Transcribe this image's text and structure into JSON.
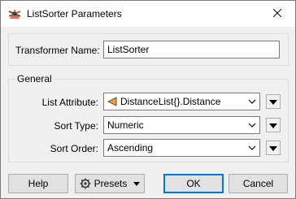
{
  "window": {
    "title": "ListSorter Parameters",
    "icon": "listsorter-app-icon",
    "close_icon": "close-icon"
  },
  "form": {
    "transformer_name_label": "Transformer Name:",
    "transformer_name_value": "ListSorter",
    "general_group_label": "General",
    "list_attribute_label": "List Attribute:",
    "list_attribute_value": "DistanceList{}.Distance",
    "list_attribute_icon": "attribute-icon",
    "sort_type_label": "Sort Type:",
    "sort_type_value": "Numeric",
    "sort_order_label": "Sort Order:",
    "sort_order_value": "Ascending"
  },
  "buttons": {
    "help": "Help",
    "presets": "Presets",
    "ok": "OK",
    "cancel": "Cancel"
  },
  "colors": {
    "accent": "#0078d7",
    "attribute_icon_fill": "#e8a23a"
  }
}
